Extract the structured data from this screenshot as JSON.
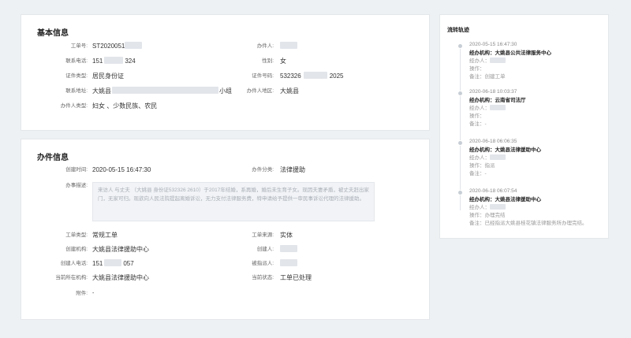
{
  "basic_info": {
    "title": "基本信息",
    "fields": [
      {
        "label": "工单号:",
        "value": "ST2020051"
      },
      {
        "label": "办件人:",
        "value": ""
      },
      {
        "label": "联系电话:",
        "value_prefix": "151",
        "value_suffix": "324"
      },
      {
        "label": "性别:",
        "value": "女"
      },
      {
        "label": "证件类型:",
        "value": "居民身份证"
      },
      {
        "label": "证件号码:",
        "value_prefix": "532326",
        "value_suffix": "2025"
      },
      {
        "label": "联系地址:",
        "value_prefix": "大姚县",
        "value_suffix": "小组"
      },
      {
        "label": "办件人地区:",
        "value": "大姚县"
      },
      {
        "label": "办件人类型:",
        "value": "妇女 、少数民族、农民"
      }
    ]
  },
  "case_info": {
    "title": "办件信息",
    "created_time_label": "创建时间:",
    "created_time": "2020-05-15 16:47:30",
    "category_label": "办件分类:",
    "category": "法律援助",
    "description_label": "办事描述:",
    "description": "来访人 与丈夫 （大姚县 身份证532326 2610）于2017年结婚，系再婚，婚后未生育子女。现因夫妻矛盾，被丈夫赶出家门，无家可归。现欲向人民法院提起离婚诉讼，无力支付法律服务费，特申请给予提供一审民事诉讼代理的法律援助。",
    "fields": [
      {
        "label": "工单类型:",
        "value": "常规工单"
      },
      {
        "label": "工单来源:",
        "value": "实体"
      },
      {
        "label": "创建机构:",
        "value": "大姚县法律援助中心"
      },
      {
        "label": "创建人:",
        "value": ""
      },
      {
        "label": "创建人电话:",
        "value_prefix": "151",
        "value_suffix": "057"
      },
      {
        "label": "被指派人:",
        "value": ""
      },
      {
        "label": "当前所在机构:",
        "value": "大姚县法律援助中心"
      },
      {
        "label": "当前状态:",
        "value": "工单已处理"
      },
      {
        "label": "附件:",
        "value": "-"
      }
    ]
  },
  "flow": {
    "title": "流转轨迹",
    "items": [
      {
        "time": "2020-05-15 16:47:30",
        "org": "经办机构：大姚县公共法律服务中心",
        "handler": "经办人：",
        "op": "操作：",
        "note": "备注：创建工单"
      },
      {
        "time": "2020-06-18 10:03:37",
        "org": "经办机构：云南省司法厅",
        "handler": "经办人：",
        "op": "操作：",
        "note": "备注：-"
      },
      {
        "time": "2020-06-18 06:06:35",
        "org": "经办机构：大姚县法律援助中心",
        "handler": "经办人：",
        "op": "操作：指派",
        "note": "备注：-"
      },
      {
        "time": "2020-06-18 06:07:54",
        "org": "经办机构：大姚县法律援助中心",
        "handler": "经办人：",
        "op": "操作：办理完结",
        "note": "备注：已经指派大姚县桂花镇法律服务所办理完结。"
      }
    ]
  },
  "colors": {
    "page_bg": "#eef1f3",
    "card_bg": "#ffffff",
    "mask": "#e2e5ea"
  }
}
